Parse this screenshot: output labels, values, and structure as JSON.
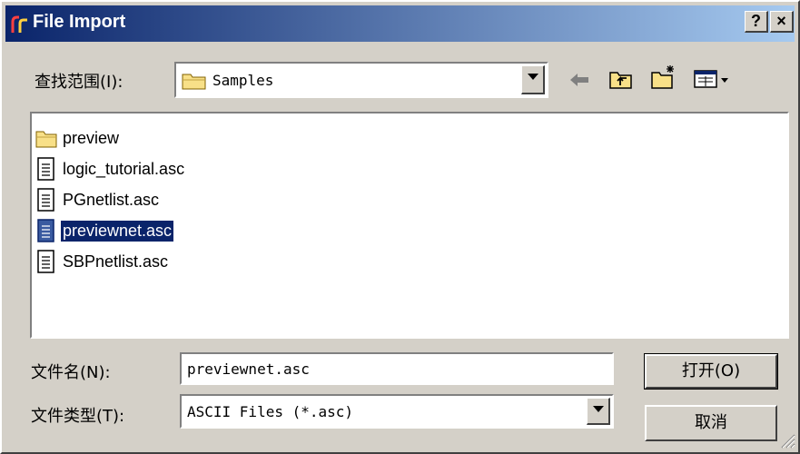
{
  "window": {
    "title": "File Import",
    "help_button": "?",
    "close_button": "×"
  },
  "lookin": {
    "label": "查找范围(I):",
    "value": "Samples"
  },
  "files": [
    {
      "name": "preview",
      "type": "folder"
    },
    {
      "name": "logic_tutorial.asc",
      "type": "file"
    },
    {
      "name": "PGnetlist.asc",
      "type": "file"
    },
    {
      "name": "previewnet.asc",
      "type": "file",
      "selected": true
    },
    {
      "name": "SBPnetlist.asc",
      "type": "file"
    }
  ],
  "filename": {
    "label": "文件名(N):",
    "value": "previewnet.asc"
  },
  "filetype": {
    "label": "文件类型(T):",
    "value": "ASCII Files (*.asc)"
  },
  "buttons": {
    "open": "打开(O)",
    "cancel": "取消"
  },
  "toolbar": {
    "back_icon": "back-arrow-icon",
    "up_icon": "up-folder-icon",
    "new_folder_icon": "new-folder-icon",
    "view_menu_icon": "view-menu-icon"
  }
}
